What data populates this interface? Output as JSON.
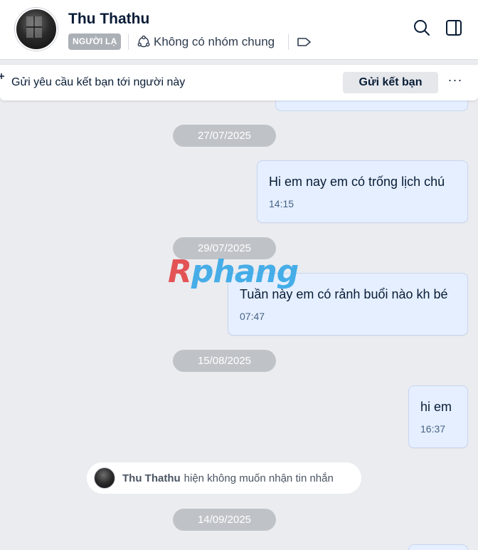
{
  "header": {
    "contact_name": "Thu Thathu",
    "stranger_badge": "NGƯỜI LẠ",
    "common_groups": "Không có nhóm chung"
  },
  "friend_request": {
    "text": "Gửi yêu cầu kết bạn tới người này",
    "button_label": "Gửi kết bạn",
    "more_label": "···"
  },
  "conversation": {
    "date_separators": [
      "27/07/2025",
      "29/07/2025",
      "15/08/2025",
      "14/09/2025"
    ],
    "messages": [
      {
        "text": "Hi em nay em có trống lịch chú",
        "time": "14:15"
      },
      {
        "text": "Tuần này em có rảnh buổi nào kh bé",
        "time": "07:47"
      },
      {
        "text": "hi em",
        "time": "16:37"
      }
    ],
    "system_notice": {
      "name": "Thu Thathu",
      "text": "hiện không muốn nhận tin nhắn"
    }
  },
  "watermark": {
    "first_letter": "R",
    "rest": "phang"
  },
  "colors": {
    "background": "#ebecf0",
    "sent_bubble": "#e5efff",
    "date_pill": "#bfc3c8",
    "badge": "#abb0b6"
  }
}
